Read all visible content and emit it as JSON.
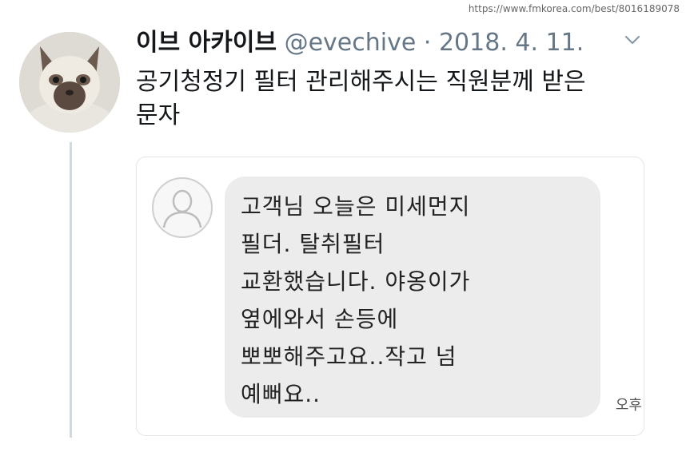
{
  "watermark": "https://www.fmkorea.com/best/8016189078",
  "tweet": {
    "display_name": "이브 아카이브",
    "handle": "@evechive",
    "separator": "·",
    "date": "2018. 4. 11.",
    "text_lines": [
      "공기청정기 필터 관리해주시는 직원분께 받은",
      "문자"
    ],
    "avatar_icon": "cat-avatar",
    "menu_icon": "chevron-down-icon"
  },
  "message": {
    "sender_icon": "contact-person-icon",
    "lines": [
      "고객님  오늘은 미세먼지",
      "필더. 탈취필터",
      "교환했습니다.  야옹이가",
      "옆에와서 손등에",
      "뽀뽀해주고요..작고 넘",
      "예뻐요.."
    ],
    "time_label": "오후"
  },
  "colors": {
    "text_primary": "#14171a",
    "text_secondary": "#657786",
    "bubble_bg": "#ececec",
    "thread_line": "#cfd9de"
  }
}
